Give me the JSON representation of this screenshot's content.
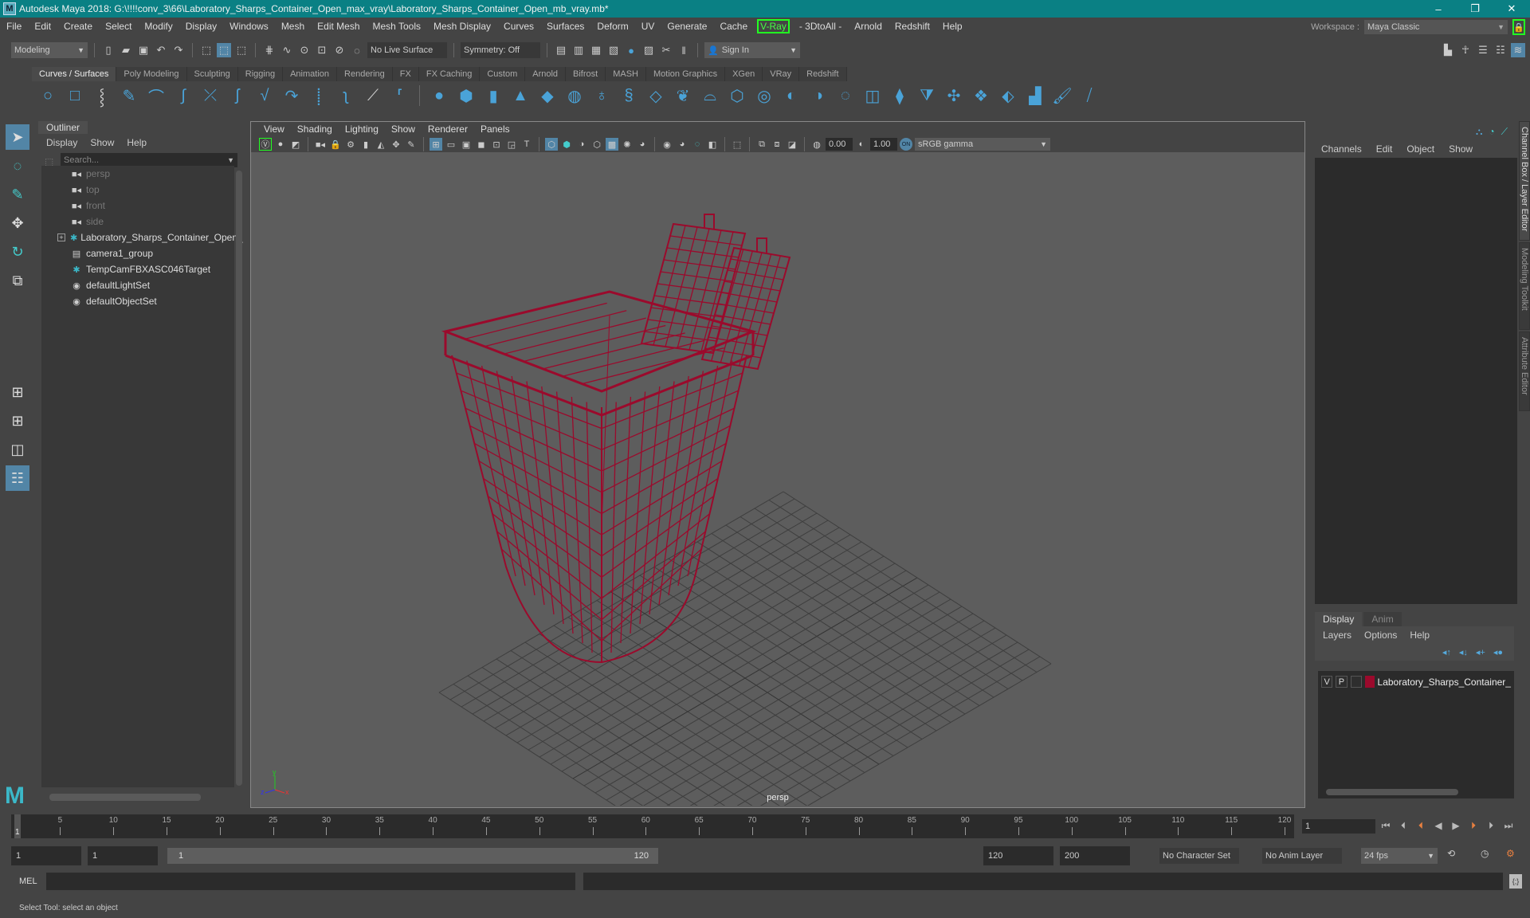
{
  "window": {
    "title": "Autodesk Maya 2018: G:\\!!!!conv_3\\66\\Laboratory_Sharps_Container_Open_max_vray\\Laboratory_Sharps_Container_Open_mb_vray.mb*",
    "logo": "M",
    "minimize": "–",
    "maximize": "❐",
    "close": "✕"
  },
  "menubar": {
    "items": [
      "File",
      "Edit",
      "Create",
      "Select",
      "Modify",
      "Display",
      "Windows",
      "Mesh",
      "Edit Mesh",
      "Mesh Tools",
      "Mesh Display",
      "Curves",
      "Surfaces",
      "Deform",
      "UV",
      "Generate",
      "Cache",
      "V-Ray",
      "- 3DtoAll -",
      "Arnold",
      "Redshift",
      "Help"
    ],
    "workspace_label": "Workspace :",
    "workspace_value": "Maya Classic",
    "lock_icon": "🔒"
  },
  "statusline": {
    "mode": "Modeling",
    "live_surface": "No Live Surface",
    "symmetry": "Symmetry: Off",
    "sign_in": "Sign In"
  },
  "shelf": {
    "tabs": [
      "Curves / Surfaces",
      "Poly Modeling",
      "Sculpting",
      "Rigging",
      "Animation",
      "Rendering",
      "FX",
      "FX Caching",
      "Custom",
      "Arnold",
      "Bifrost",
      "MASH",
      "Motion Graphics",
      "XGen",
      "VRay",
      "Redshift"
    ],
    "active_tab": "Curves / Surfaces"
  },
  "outliner": {
    "title": "Outliner",
    "menus": [
      "Display",
      "Show",
      "Help"
    ],
    "search_placeholder": "Search...",
    "items": [
      {
        "label": "persp",
        "icon": "camera-icon",
        "dim": true
      },
      {
        "label": "top",
        "icon": "camera-icon",
        "dim": true
      },
      {
        "label": "front",
        "icon": "camera-icon",
        "dim": true
      },
      {
        "label": "side",
        "icon": "camera-icon",
        "dim": true
      },
      {
        "label": "Laboratory_Sharps_Container_Open_",
        "icon": "transform-star-icon",
        "dim": false,
        "expandable": true
      },
      {
        "label": "camera1_group",
        "icon": "group-icon",
        "dim": false
      },
      {
        "label": "TempCamFBXASC046Target",
        "icon": "transform-star-icon",
        "dim": false
      },
      {
        "label": "defaultLightSet",
        "icon": "set-icon",
        "dim": false
      },
      {
        "label": "defaultObjectSet",
        "icon": "set-icon",
        "dim": false
      }
    ]
  },
  "viewport": {
    "menus": [
      "View",
      "Shading",
      "Lighting",
      "Show",
      "Renderer",
      "Panels"
    ],
    "exposure": "0.00",
    "gamma": "1.00",
    "color_space": "sRGB gamma",
    "color_mgmt_on": "ON",
    "camera": "persp",
    "axis_labels": {
      "x": "x",
      "y": "y",
      "z": "z"
    },
    "wire_color": "#9b0a2c"
  },
  "channel_box": {
    "menus": [
      "Channels",
      "Edit",
      "Object",
      "Show"
    ]
  },
  "side_tabs": [
    "Channel Box / Layer Editor",
    "Modeling Toolkit",
    "Attribute Editor"
  ],
  "layer_editor": {
    "tabs": [
      "Display",
      "Anim"
    ],
    "active_tab": "Display",
    "menus": [
      "Layers",
      "Options",
      "Help"
    ],
    "layers": [
      {
        "visible": "V",
        "playback": "P",
        "name": "Laboratory_Sharps_Container_",
        "color": "#9b0a2c"
      }
    ]
  },
  "timeline": {
    "tick_labels": [
      "5",
      "10",
      "15",
      "20",
      "25",
      "30",
      "35",
      "40",
      "45",
      "50",
      "55",
      "60",
      "65",
      "70",
      "75",
      "80",
      "85",
      "90",
      "95",
      "100",
      "105",
      "110",
      "115",
      "120"
    ],
    "current_marker": "1",
    "current_frame": "1",
    "start_time": "1",
    "playback_start": "1",
    "range_start": "1",
    "range_end": "120",
    "playback_end": "120",
    "end_time": "200",
    "character_set": "No Character Set",
    "anim_layer": "No Anim Layer",
    "fps": "24 fps"
  },
  "command_line": {
    "label": "MEL",
    "value": ""
  },
  "help_line": {
    "text": "Select Tool: select an object"
  }
}
